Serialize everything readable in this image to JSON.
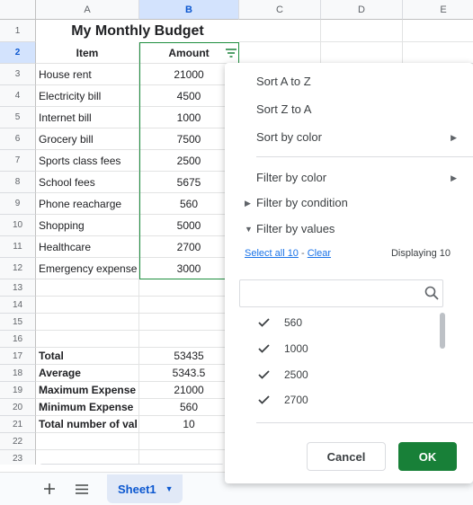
{
  "columns": [
    "A",
    "B",
    "C",
    "D",
    "E"
  ],
  "selected_column": "B",
  "rows": [
    "1",
    "2",
    "3",
    "4",
    "5",
    "6",
    "7",
    "8",
    "9",
    "10",
    "11",
    "12",
    "13",
    "14",
    "15",
    "16",
    "17",
    "18",
    "19",
    "20",
    "21",
    "22",
    "23"
  ],
  "title": "My Monthly Budget",
  "header": {
    "item": "Item",
    "amount": "Amount"
  },
  "items": [
    {
      "name": "House rent",
      "amount": "21000"
    },
    {
      "name": "Electricity bill",
      "amount": "4500"
    },
    {
      "name": "Internet bill",
      "amount": "1000"
    },
    {
      "name": "Grocery bill",
      "amount": "7500"
    },
    {
      "name": "Sports class fees",
      "amount": "2500"
    },
    {
      "name": "School fees",
      "amount": "5675"
    },
    {
      "name": "Phone reacharge",
      "amount": "560"
    },
    {
      "name": "Shopping",
      "amount": "5000"
    },
    {
      "name": "Healthcare",
      "amount": "2700"
    },
    {
      "name": "Emergency expense",
      "amount": "3000"
    }
  ],
  "summary": [
    {
      "label": "Total",
      "value": "53435"
    },
    {
      "label": "Average",
      "value": "5343.5"
    },
    {
      "label": "Maximum Expense",
      "value": "21000"
    },
    {
      "label": "Minimum Expense",
      "value": "560"
    },
    {
      "label": "Total number of val",
      "value": "10"
    }
  ],
  "sheet_tab": "Sheet1",
  "filter_menu": {
    "sort_az": "Sort A to Z",
    "sort_za": "Sort Z to A",
    "sort_color": "Sort by color",
    "filter_color": "Filter by color",
    "filter_condition": "Filter by condition",
    "filter_values": "Filter by values",
    "select_all": "Select all 10",
    "dash": "-",
    "clear": "Clear",
    "displaying": "Displaying 10",
    "search_placeholder": "",
    "values": [
      "560",
      "1000",
      "2500",
      "2700"
    ],
    "cancel": "Cancel",
    "ok": "OK"
  },
  "colors": {
    "accent": "#188038",
    "selection": "#d3e3fd",
    "link": "#1a73e8"
  }
}
